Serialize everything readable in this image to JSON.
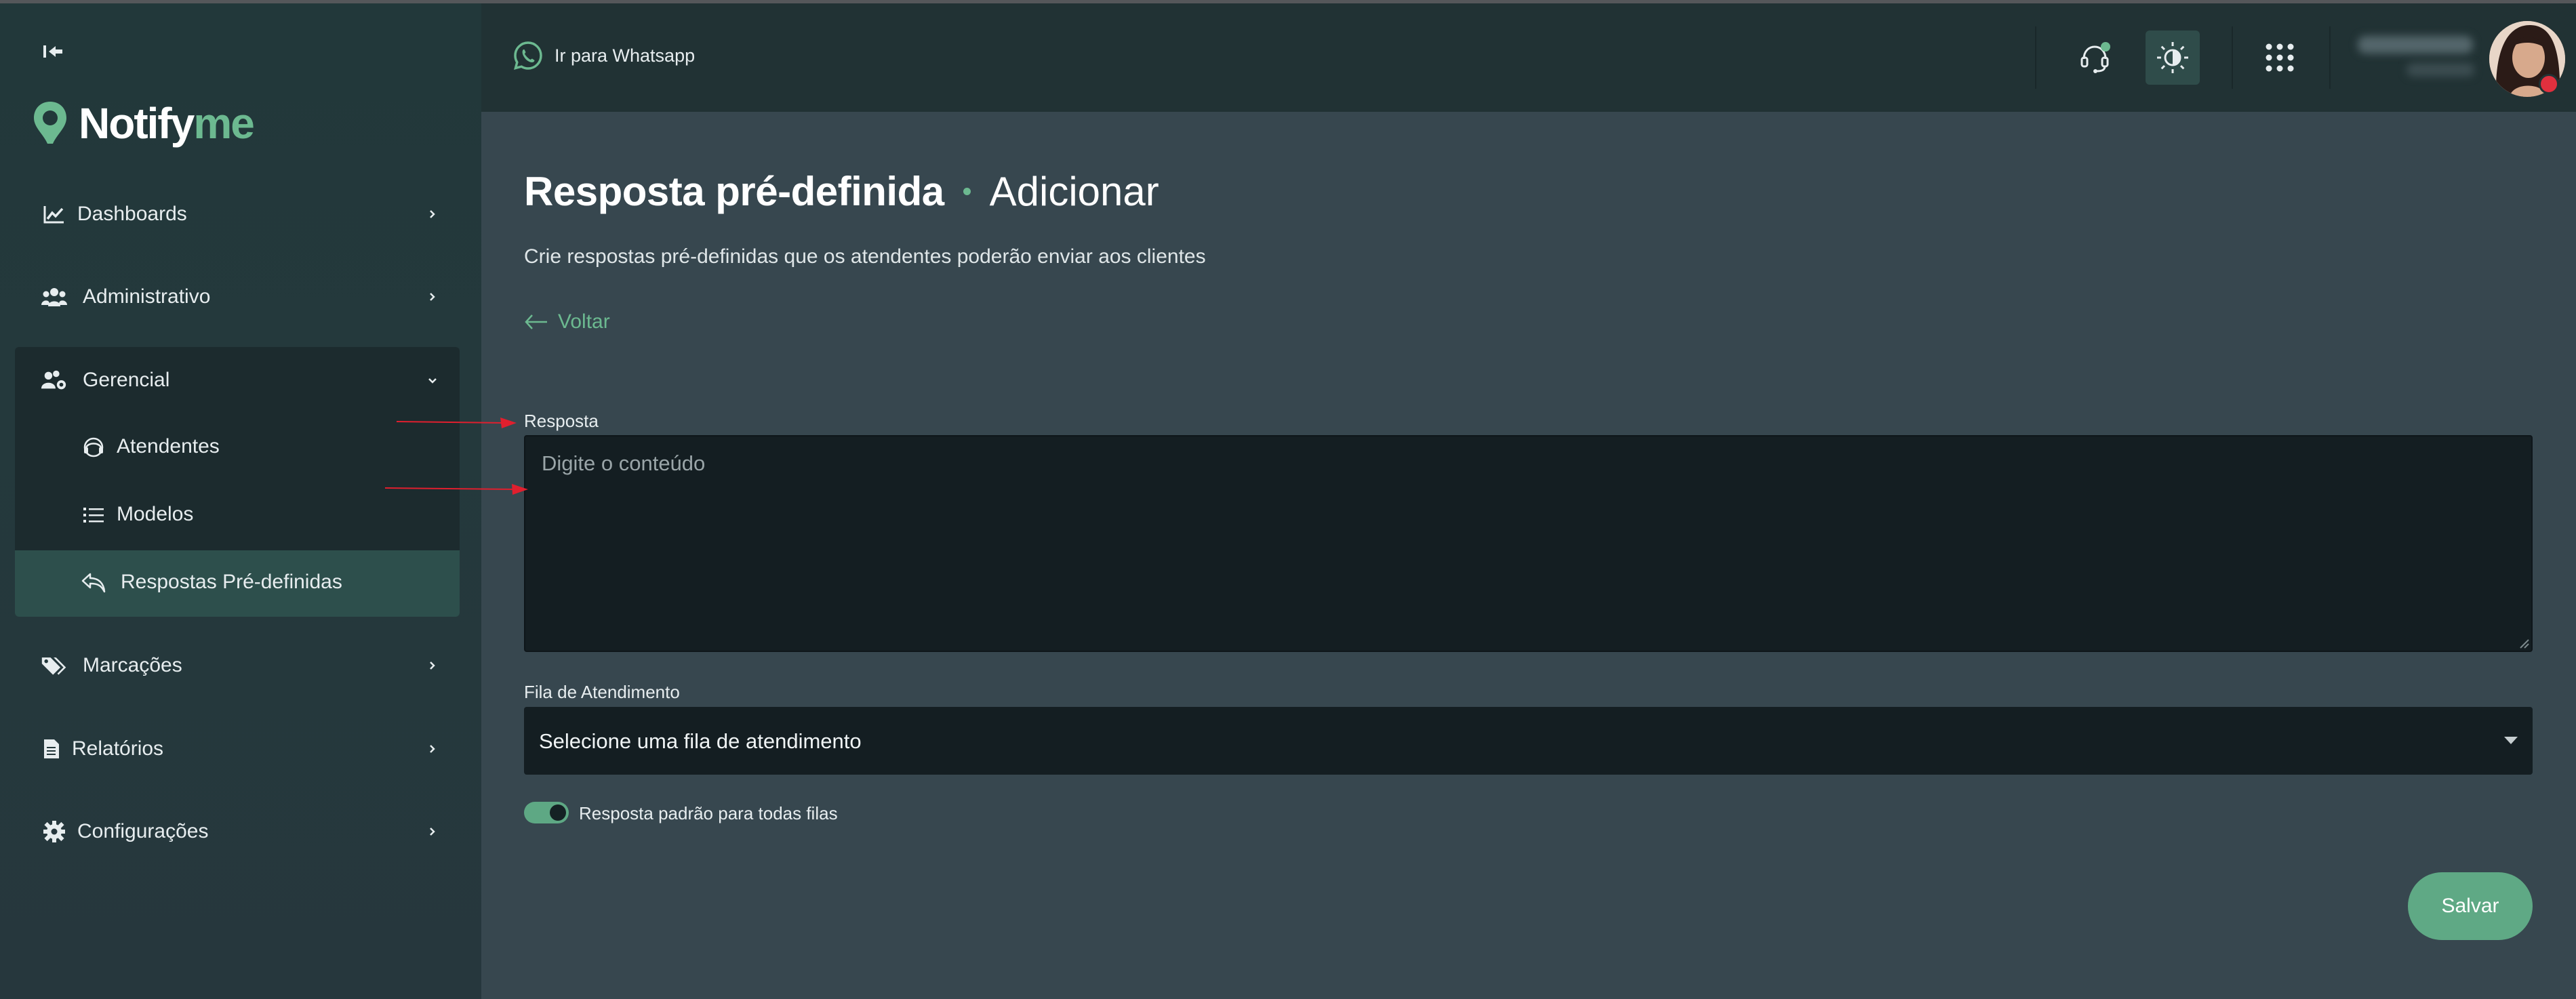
{
  "app": {
    "brand_name": "Notifyme",
    "brand_main": "Notify",
    "brand_accent": "me",
    "accent_color": "#6cb990"
  },
  "sidebar": {
    "items": [
      {
        "label": "Dashboards",
        "icon": "chart-line-icon",
        "expanded": false
      },
      {
        "label": "Administrativo",
        "icon": "users-group-icon",
        "expanded": false
      },
      {
        "label": "Gerencial",
        "icon": "users-gear-icon",
        "expanded": true,
        "children": [
          {
            "label": "Atendentes",
            "icon": "headset-icon"
          },
          {
            "label": "Modelos",
            "icon": "list-icon"
          },
          {
            "label": "Respostas Pré-definidas",
            "icon": "reply-icon",
            "active": true
          }
        ]
      },
      {
        "label": "Marcações",
        "icon": "tags-icon",
        "expanded": false
      },
      {
        "label": "Relatórios",
        "icon": "document-icon",
        "expanded": false
      },
      {
        "label": "Configurações",
        "icon": "gear-icon",
        "expanded": false
      }
    ]
  },
  "header": {
    "whatsapp_link": "Ir para Whatsapp"
  },
  "page": {
    "title": "Resposta pré-definida",
    "title_action": "Adicionar",
    "subtitle": "Crie respostas pré-definidas que os atendentes poderão enviar aos clientes",
    "back_label": "Voltar"
  },
  "form": {
    "response_label": "Resposta",
    "response_placeholder": "Digite o conteúdo",
    "response_value": "",
    "queue_label": "Fila de Atendimento",
    "queue_selected": "Selecione uma fila de atendimento",
    "default_toggle_label": "Resposta padrão para todas filas",
    "default_toggle_on": true,
    "save_label": "Salvar"
  }
}
